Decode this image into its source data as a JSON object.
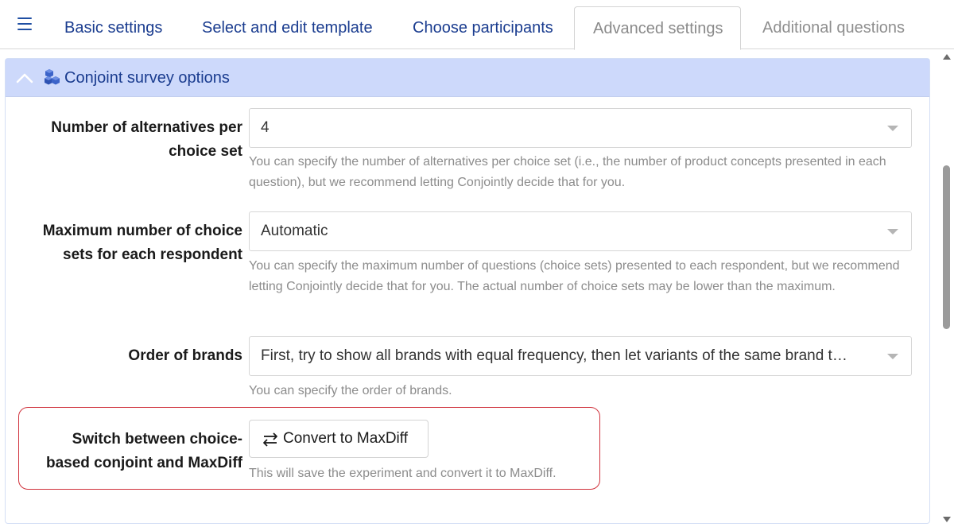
{
  "tabs": [
    {
      "label": "Basic settings"
    },
    {
      "label": "Select and edit template"
    },
    {
      "label": "Choose participants"
    },
    {
      "label": "Advanced settings"
    },
    {
      "label": "Additional questions"
    }
  ],
  "panel": {
    "title": "Conjoint survey options"
  },
  "fields": {
    "alternatives": {
      "label_line1": "Number of alternatives per",
      "label_line2": "choice set",
      "value": "4",
      "help": "You can specify the number of alternatives per choice set (i.e., the number of product concepts presented in each question), but we recommend letting Conjointly decide that for you."
    },
    "max_sets": {
      "label_line1": "Maximum number of choice",
      "label_line2": "sets for each respondent",
      "value": "Automatic",
      "help": "You can specify the maximum number of questions (choice sets) presented to each respondent, but we recommend letting Conjointly decide that for you. The actual number of choice sets may be lower than the maximum."
    },
    "order_brands": {
      "label": "Order of brands",
      "value": "First, try to show all brands with equal frequency, then let variants of the same brand t…",
      "help": "You can specify the order of brands."
    },
    "switch": {
      "label_line1": "Switch between choice-",
      "label_line2": "based conjoint and MaxDiff",
      "button_label": "Convert to MaxDiff",
      "help": "This will save the experiment and convert it to MaxDiff."
    }
  },
  "colors": {
    "accent": "#1a3c8f",
    "panel_header": "#cdd9fb",
    "highlight_border": "#d0323c"
  },
  "icons": [
    "menu-icon",
    "chevron-up-icon",
    "cubes-icon",
    "swap-arrows-icon",
    "caret-down-icon"
  ]
}
